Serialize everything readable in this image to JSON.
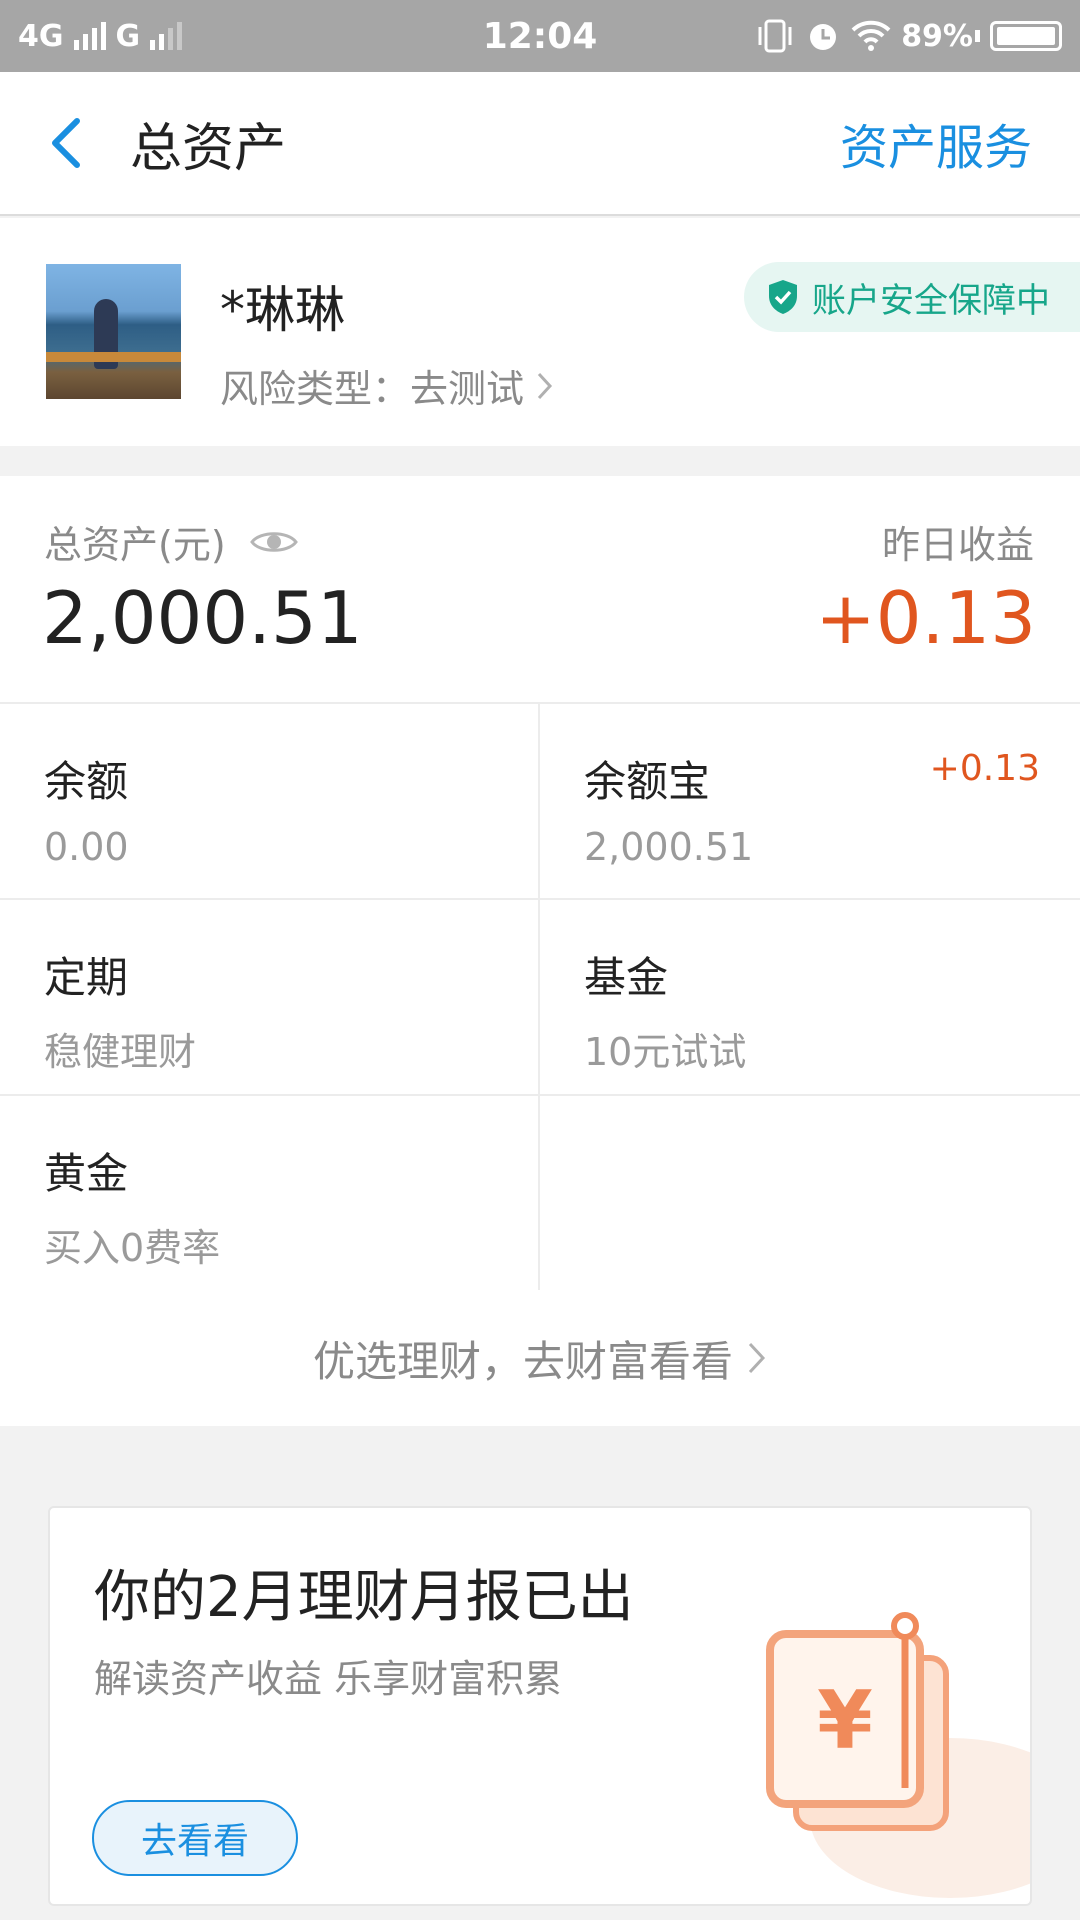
{
  "status_bar": {
    "network1": "4G",
    "network2": "G",
    "time": "12:04",
    "battery": "89%"
  },
  "nav": {
    "title": "总资产",
    "action": "资产服务"
  },
  "profile": {
    "name": "*琳琳",
    "risk_label": "风险类型：去测试",
    "security_badge": "账户安全保障中"
  },
  "summary": {
    "total_label": "总资产(元)",
    "total_value": "2,000.51",
    "yesterday_label": "昨日收益",
    "yesterday_value": "+0.13"
  },
  "accounts": [
    {
      "title": "余额",
      "sub": "0.00",
      "badge": ""
    },
    {
      "title": "余额宝",
      "sub": "2,000.51",
      "badge": "+0.13"
    },
    {
      "title": "定期",
      "sub": "稳健理财",
      "badge": ""
    },
    {
      "title": "基金",
      "sub": "10元试试",
      "badge": ""
    },
    {
      "title": "黄金",
      "sub": "买入0费率",
      "badge": ""
    }
  ],
  "more_link": "优选理财，去财富看看",
  "report_card": {
    "title": "你的2月理财月报已出",
    "subtitle": "解读资产收益 乐享财富积累",
    "button": "去看看"
  },
  "colors": {
    "accent": "#1a8fe0",
    "gain": "#e0561f",
    "security": "#17a68a"
  },
  "icons": [
    "back-arrow-icon",
    "shield-check-icon",
    "chevron-right-icon",
    "eye-icon",
    "yuan-report-icon"
  ]
}
